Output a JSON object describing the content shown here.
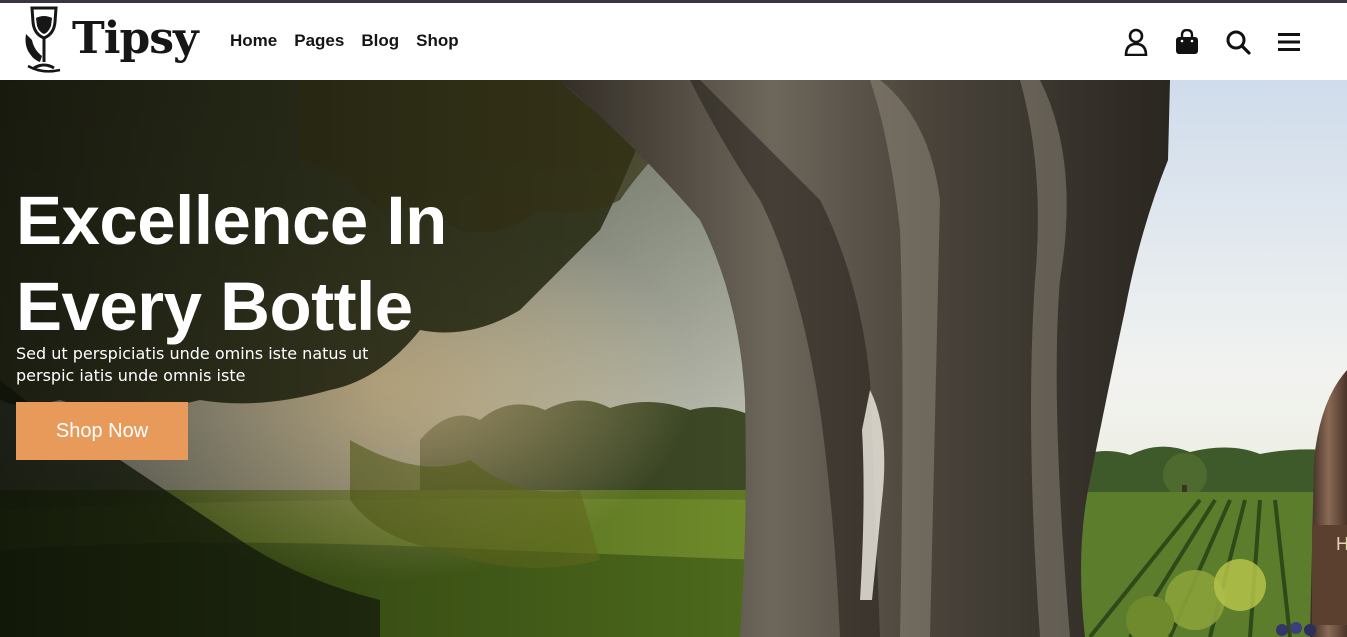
{
  "brand": {
    "name": "Tipsy",
    "logo_icon": "wine-glass-hand-icon"
  },
  "nav": {
    "items": [
      {
        "label": "Home"
      },
      {
        "label": "Pages"
      },
      {
        "label": "Blog"
      },
      {
        "label": "Shop"
      }
    ]
  },
  "header_icons": [
    "user-icon",
    "shopping-bag-icon",
    "search-icon",
    "menu-icon"
  ],
  "hero": {
    "title_line1": "Excellence In",
    "title_line2": "Every Bottle",
    "subtitle": "Sed ut perspiciatis unde omins iste natus ut perspic iatis unde omnis iste",
    "cta_label": "Shop Now",
    "background_image": "vineyard-with-oak-tree-and-wine-bottle"
  },
  "colors": {
    "accent": "#e89a5b",
    "text_dark": "#151515",
    "top_line": "#3a3540"
  }
}
